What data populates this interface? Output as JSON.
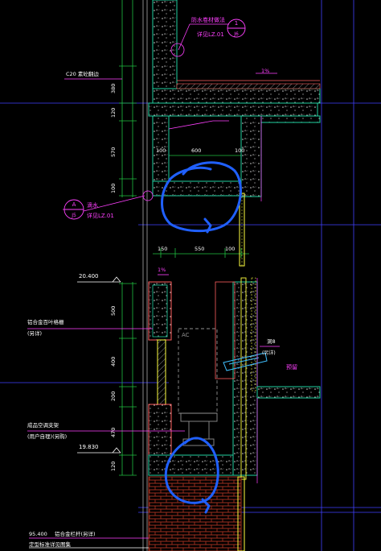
{
  "colors": {
    "background": "#000000",
    "concrete_outline": "#20d0a0",
    "hatch": "#e0e0e0",
    "dimension": "#20c040",
    "annotation": "#ff40ff",
    "frame": "#ffff40",
    "axis": "#4040ff",
    "brick": "#a03020",
    "ink": "#2060ff",
    "insulation": "#ff6060",
    "equipment": "#909090",
    "text_white": "#ffffff"
  },
  "labels": {
    "top_note": "防水卷材做法",
    "top_note_ref": "详见LZ.01",
    "bubble_top_num": "1",
    "bubble_top_ref": "J6",
    "c20": "C20 素砼翻边",
    "slope_top": "1%",
    "slope_mid": "1%",
    "bubble_left_letter": "A",
    "bubble_left_ref": "J5",
    "left_note": "滴水",
    "left_note_ref": "详见LZ.01",
    "level_1": "20.400",
    "level_2": "19.830",
    "level_3": "95.400",
    "note_a": "铝合金百叶格栅",
    "note_b": "(另详)",
    "note_c": "成品空调支架",
    "note_d": "(用户自理)(另购)",
    "note_e": "铝合金栏杆(另详)",
    "note_f": "定型标准详见图集",
    "ac_label": "AC",
    "right_note": "预留",
    "right_mark": "洞8",
    "right_mark_2": "(另详)"
  },
  "dimensions": {
    "upper_vertical": [
      "380",
      "120",
      "570",
      "100"
    ],
    "upper_horizontal": [
      "100",
      "600",
      "100"
    ],
    "lower_horizontal": [
      "150",
      "550",
      "100"
    ],
    "lower_vertical": [
      "500",
      "400",
      "200",
      "470",
      "120"
    ]
  }
}
